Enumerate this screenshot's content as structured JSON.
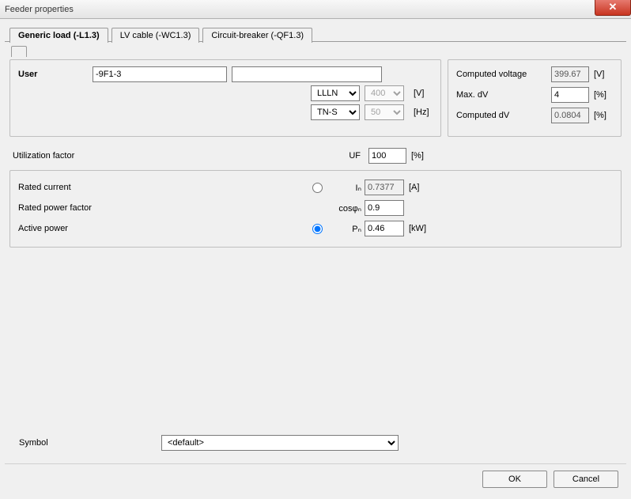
{
  "window": {
    "title": "Feeder properties"
  },
  "tabs": [
    {
      "label": "Generic load (-L1.3)"
    },
    {
      "label": "LV cable (-WC1.3)"
    },
    {
      "label": "Circuit-breaker (-QF1.3)"
    }
  ],
  "user": {
    "label": "User",
    "value1": "-9F1-3",
    "value2": "",
    "phase_system": "LLLN",
    "voltage": "400",
    "voltage_unit": "[V]",
    "earth_system": "TN-S",
    "freq": "50",
    "freq_unit": "[Hz]"
  },
  "computed": {
    "voltage_label": "Computed voltage",
    "voltage_val": "399.67",
    "voltage_unit": "[V]",
    "maxdv_label": "Max. dV",
    "maxdv_val": "4",
    "maxdv_unit": "[%]",
    "compdv_label": "Computed dV",
    "compdv_val": "0.0804",
    "compdv_unit": "[%]"
  },
  "utilization": {
    "label": "Utilization factor",
    "symbol": "UF",
    "value": "100",
    "unit": "[%]"
  },
  "rated": {
    "current_label": "Rated current",
    "current_sym": "Iₙ",
    "current_val": "0.7377",
    "current_unit": "[A]",
    "pf_label": "Rated power factor",
    "pf_sym": "cosφₙ",
    "pf_val": "0.9",
    "ap_label": "Active power",
    "ap_sym": "Pₙ",
    "ap_val": "0.46",
    "ap_unit": "[kW]"
  },
  "symbol": {
    "label": "Symbol",
    "value": "<default>"
  },
  "buttons": {
    "ok": "OK",
    "cancel": "Cancel"
  }
}
